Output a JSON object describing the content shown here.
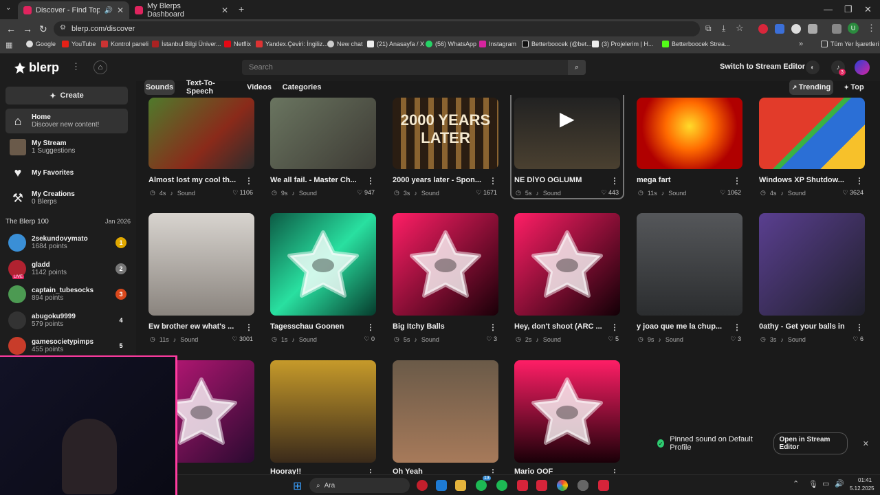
{
  "browser": {
    "tabs": [
      {
        "title": "Discover - Find Top Blerps",
        "active": true
      },
      {
        "title": "My Blerps Dashboard",
        "active": false
      }
    ],
    "new_tab": "+",
    "url": "blerp.com/discover",
    "bookmarks": [
      "Google",
      "YouTube",
      "Kontrol paneli",
      "İstanbul Bilgi Üniver...",
      "Netflix",
      "Yandex.Çeviri: İngiliz...",
      "New chat",
      "(21) Anasayfa / X",
      "(56) WhatsApp",
      "Instagram",
      "Betterboocek (@bet...",
      "(3) Projelerim | H...",
      "Betterboocek Strea..."
    ],
    "all_bookmarks": "Tüm Yer İşaretleri",
    "profile_initial": "U"
  },
  "header": {
    "logo": "blerp",
    "search_placeholder": "Search",
    "stream_editor": "Switch to Stream Editor",
    "notif_count": "3"
  },
  "filters": {
    "tabs": [
      "Sounds",
      "Text-To-Speech",
      "Videos",
      "Categories"
    ],
    "trending": "Trending",
    "top": "Top"
  },
  "sidebar": {
    "create": "Create",
    "nav": [
      {
        "title": "Home",
        "sub": "Discover new content!"
      },
      {
        "title": "My Stream",
        "sub": "1 Suggestions"
      },
      {
        "title": "My Favorites",
        "sub": ""
      },
      {
        "title": "My Creations",
        "sub": "0 Blerps"
      }
    ],
    "leaderboard_title": "The Blerp 100",
    "leaderboard_date": "Jan 2026",
    "leaders": [
      {
        "name": "2sekundovymato",
        "points": "1684 points",
        "rank": "1",
        "rank_color": "#e0a800"
      },
      {
        "name": "gladd",
        "points": "1142 points",
        "rank": "2",
        "rank_color": "#777777"
      },
      {
        "name": "captain_tubesocks",
        "points": "894 points",
        "rank": "3",
        "rank_color": "#d9481c"
      },
      {
        "name": "abugoku9999",
        "points": "579 points",
        "rank": "4",
        "rank_color": "#1d1d1d"
      },
      {
        "name": "gamesocietypimps",
        "points": "455 points",
        "rank": "5",
        "rank_color": "#1d1d1d"
      }
    ],
    "live_label": "LIVE"
  },
  "grid": {
    "sound_label": "Sound",
    "rows": [
      [
        {
          "title": "Almost lost my cool th...",
          "dur": "4s",
          "likes": "1106"
        },
        {
          "title": "We all fail. - Master Ch...",
          "dur": "9s",
          "likes": "947"
        },
        {
          "title": "2000 years later - Spon...",
          "dur": "3s",
          "likes": "1671"
        },
        {
          "title": "NE DİYO OGLUMM",
          "dur": "5s",
          "likes": "443"
        },
        {
          "title": "mega fart",
          "dur": "11s",
          "likes": "1062"
        },
        {
          "title": "Windows XP Shutdow...",
          "dur": "4s",
          "likes": "3624"
        }
      ],
      [
        {
          "title": "Ew brother ew what's ...",
          "dur": "11s",
          "likes": "3001"
        },
        {
          "title": "Tagesschau Goonen",
          "dur": "1s",
          "likes": "0"
        },
        {
          "title": "Big Itchy Balls",
          "dur": "5s",
          "likes": "3"
        },
        {
          "title": "Hey, don't shoot (ARC ...",
          "dur": "2s",
          "likes": "5"
        },
        {
          "title": "y joao que me la chup...",
          "dur": "9s",
          "likes": "3"
        },
        {
          "title": "0athy - Get your balls in",
          "dur": "3s",
          "likes": "6"
        }
      ],
      [
        {
          "title": "",
          "dur": "",
          "likes": ""
        },
        {
          "title": "Hooray!!",
          "dur": "",
          "likes": ""
        },
        {
          "title": "Oh Yeah",
          "dur": "",
          "likes": ""
        },
        {
          "title": "Mario OOF",
          "dur": "",
          "likes": ""
        }
      ]
    ],
    "thumb_text": "2000 YEARS LATER"
  },
  "toast": {
    "message": "Pinned sound on Default Profile",
    "button": "Open in Stream Editor"
  },
  "taskbar": {
    "search": "Ara",
    "time": "01:41",
    "date": "5.12.2025",
    "badge": "13"
  }
}
